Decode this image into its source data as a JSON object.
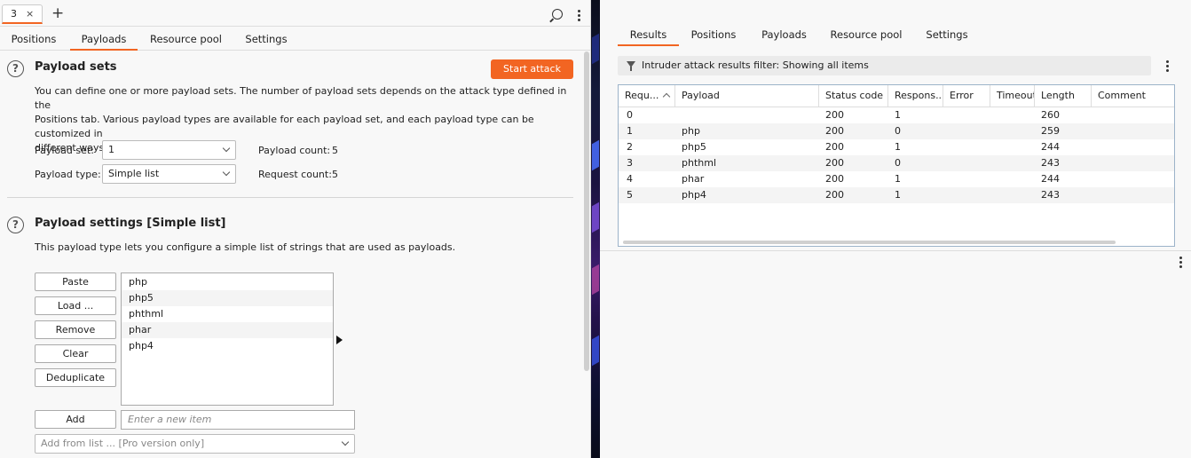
{
  "left": {
    "page_tab": {
      "label": "3",
      "close": "×"
    },
    "add_tab": "+",
    "tabs": [
      {
        "label": "Positions"
      },
      {
        "label": "Payloads"
      },
      {
        "label": "Resource pool"
      },
      {
        "label": "Settings"
      }
    ],
    "payload_sets": {
      "title": "Payload sets",
      "help": "?",
      "start_attack": "Start attack",
      "description_lines": [
        "You can define one or more payload sets. The number of payload sets depends on the attack type defined in the",
        "Positions tab. Various payload types are available for each payload set, and each payload type can be customized in",
        "different ways."
      ],
      "set_label": "Payload set:",
      "set_value": "1",
      "type_label": "Payload type:",
      "type_value": "Simple list",
      "count_label": "Payload count:",
      "count_value": "5",
      "request_label": "Request count:",
      "request_value": "5"
    },
    "payload_settings": {
      "title": "Payload settings [Simple list]",
      "help": "?",
      "description": "This payload type lets you configure a simple list of strings that are used as payloads.",
      "buttons": [
        "Paste",
        "Load ...",
        "Remove",
        "Clear",
        "Deduplicate"
      ],
      "items": [
        "php",
        "php5",
        "phthml",
        "phar",
        "php4"
      ],
      "add_button": "Add",
      "new_item_placeholder": "Enter a new item",
      "add_from_list": "Add from list ... [Pro version only]"
    }
  },
  "right": {
    "tabs": [
      {
        "label": "Results"
      },
      {
        "label": "Positions"
      },
      {
        "label": "Payloads"
      },
      {
        "label": "Resource pool"
      },
      {
        "label": "Settings"
      }
    ],
    "filter_text": "Intruder attack results filter: Showing all items",
    "columns": [
      "Requ...",
      "Payload",
      "Status code",
      "Respons...",
      "Error",
      "Timeout",
      "Length",
      "Comment"
    ],
    "rows": [
      [
        "0",
        "",
        "200",
        "1",
        "",
        "",
        "260",
        ""
      ],
      [
        "1",
        "php",
        "200",
        "0",
        "",
        "",
        "259",
        ""
      ],
      [
        "2",
        "php5",
        "200",
        "1",
        "",
        "",
        "244",
        ""
      ],
      [
        "3",
        "phthml",
        "200",
        "0",
        "",
        "",
        "243",
        ""
      ],
      [
        "4",
        "phar",
        "200",
        "1",
        "",
        "",
        "244",
        ""
      ],
      [
        "5",
        "php4",
        "200",
        "1",
        "",
        "",
        "243",
        ""
      ]
    ]
  },
  "colors": {
    "accent": "#f26522",
    "table_border": "#9cb3c9"
  }
}
